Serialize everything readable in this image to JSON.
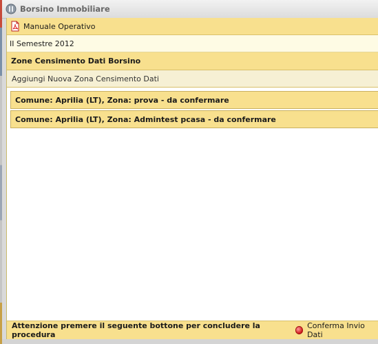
{
  "window": {
    "title": "Borsino Immobiliare",
    "icon": "borsino-app-icon"
  },
  "toolbar": {
    "manual_label": "Manuale Operativo",
    "manual_icon": "pdf-icon"
  },
  "period": {
    "label": "II Semestre 2012"
  },
  "section": {
    "title": "Zone Censimento Dati Borsino"
  },
  "actions": {
    "add_zone_label": "Aggiungi Nuova Zona Censimento Dati"
  },
  "zones": [
    {
      "label": "Comune: Aprilia (LT), Zona: prova - da confermare"
    },
    {
      "label": "Comune: Aprilia (LT), Zona: Admintest pcasa - da confermare"
    }
  ],
  "footer": {
    "notice": "Attenzione premere il seguente bottone per concludere la procedura",
    "confirm_label": "Conferma Invio Dati",
    "confirm_icon": "red-dot-icon"
  },
  "colors": {
    "header_yellow": "#f8e08e",
    "light_yellow": "#fefbe4",
    "status_red": "#d01b1b"
  }
}
